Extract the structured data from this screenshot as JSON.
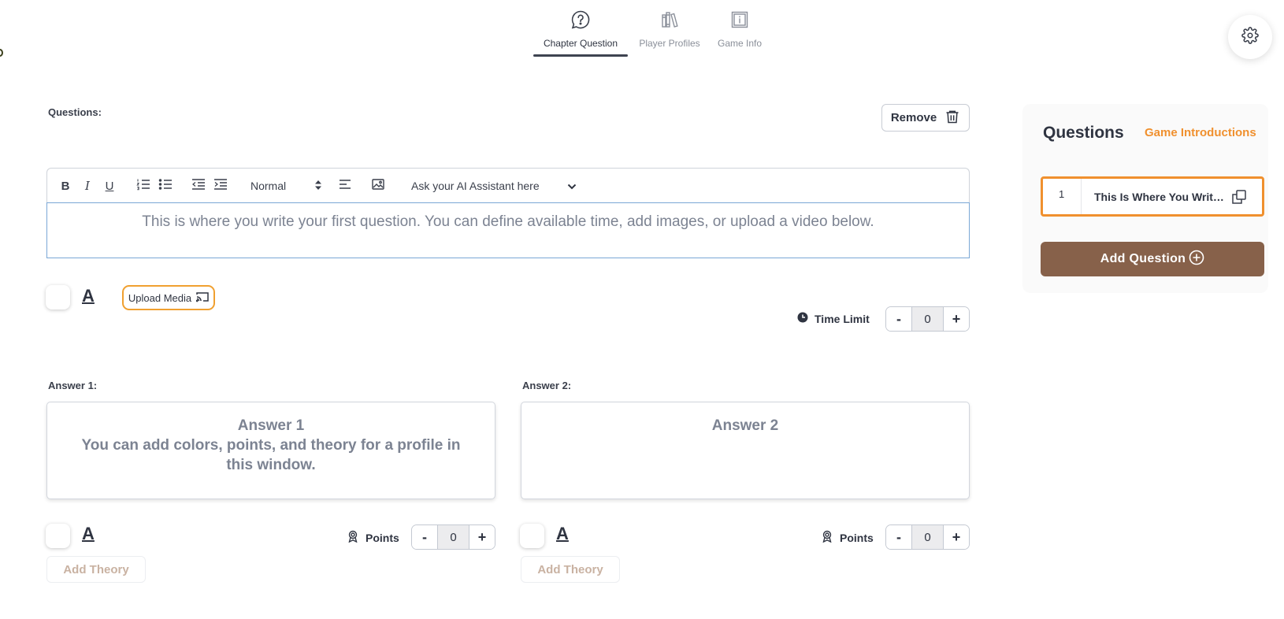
{
  "nav": {
    "tabs": [
      {
        "label": "Chapter Question",
        "icon": "chat-question-icon",
        "active": true
      },
      {
        "label": "Player Profiles",
        "icon": "books-icon",
        "active": false
      },
      {
        "label": "Game Info",
        "icon": "info-icon",
        "active": false
      }
    ]
  },
  "editor": {
    "section_label": "Questions:",
    "remove_label": "Remove",
    "heading_select": "Normal",
    "ai_select": "Ask your AI Assistant here",
    "placeholder": "This is where you write your first question. You can define available time, add images, or upload a video below.",
    "upload_label": "Upload Media",
    "time_limit_label": "Time Limit",
    "time_limit_value": "0"
  },
  "answers": [
    {
      "label": "Answer 1:",
      "title": "Answer 1",
      "body": "You can add colors, points, and theory for a profile in this window.",
      "points_label": "Points",
      "points_value": "0",
      "theory_label": "Add Theory"
    },
    {
      "label": "Answer 2:",
      "title": "Answer 2",
      "body": "",
      "points_label": "Points",
      "points_value": "0",
      "theory_label": "Add Theory"
    }
  ],
  "panel": {
    "title": "Questions",
    "link": "Game Introductions",
    "items": [
      {
        "number": "1",
        "text": "This Is Where You Write Your First Question"
      }
    ],
    "add_label": "Add Question"
  },
  "stepper": {
    "minus": "-",
    "plus": "+"
  },
  "colors": {
    "accent_orange": "#f0902e",
    "brown_button": "#87614a",
    "editor_focus": "#7aa7d6"
  }
}
